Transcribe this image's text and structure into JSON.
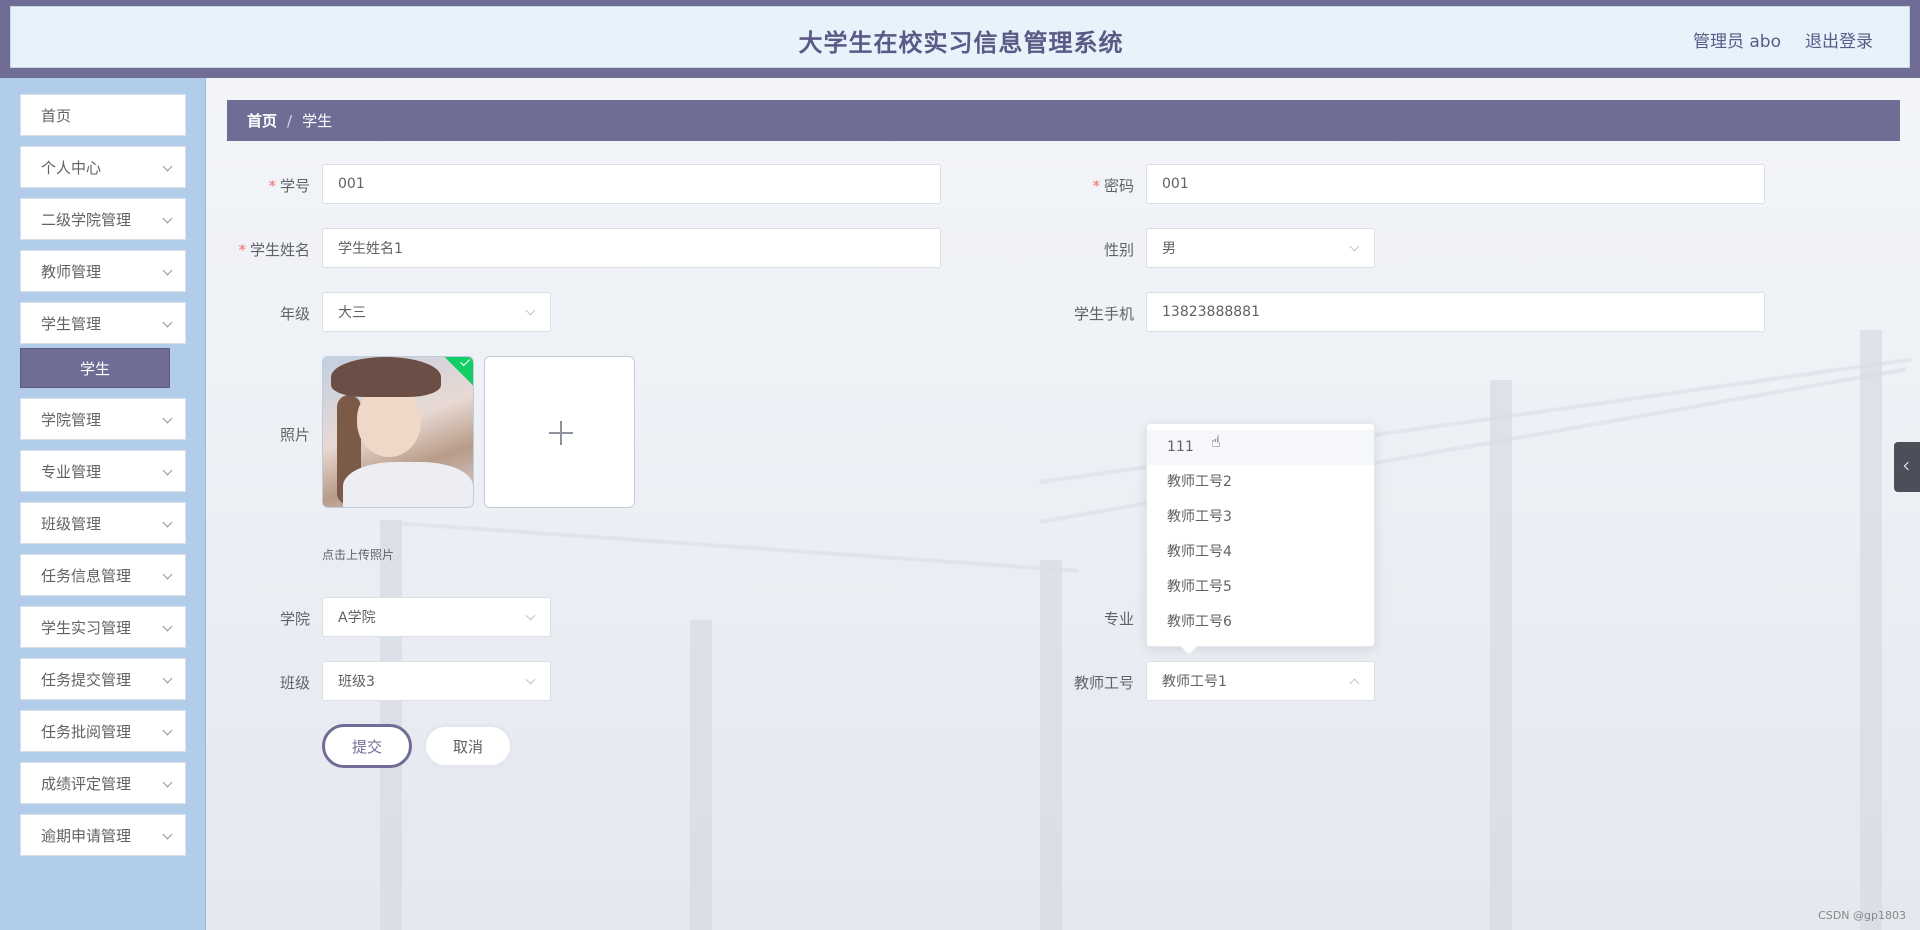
{
  "header": {
    "title": "大学生在校实习信息管理系统",
    "user_label": "管理员 abo",
    "logout_label": "退出登录"
  },
  "sidebar": {
    "items": [
      {
        "label": "首页",
        "has_children": false
      },
      {
        "label": "个人中心",
        "has_children": true
      },
      {
        "label": "二级学院管理",
        "has_children": true
      },
      {
        "label": "教师管理",
        "has_children": true
      },
      {
        "label": "学生管理",
        "has_children": true
      },
      {
        "label": "学院管理",
        "has_children": true
      },
      {
        "label": "专业管理",
        "has_children": true
      },
      {
        "label": "班级管理",
        "has_children": true
      },
      {
        "label": "任务信息管理",
        "has_children": true
      },
      {
        "label": "学生实习管理",
        "has_children": true
      },
      {
        "label": "任务提交管理",
        "has_children": true
      },
      {
        "label": "任务批阅管理",
        "has_children": true
      },
      {
        "label": "成绩评定管理",
        "has_children": true
      },
      {
        "label": "逾期申请管理",
        "has_children": true
      }
    ],
    "active_sub": "学生"
  },
  "breadcrumb": {
    "home": "首页",
    "separator": "/",
    "current": "学生"
  },
  "form": {
    "student_id": {
      "label": "学号",
      "value": "001",
      "required": "*"
    },
    "password": {
      "label": "密码",
      "value": "001",
      "required": "*"
    },
    "student_name": {
      "label": "学生姓名",
      "value": "学生姓名1",
      "required": "*"
    },
    "gender": {
      "label": "性别",
      "value": "男"
    },
    "grade": {
      "label": "年级",
      "value": "大三"
    },
    "phone": {
      "label": "学生手机",
      "value": "13823888881"
    },
    "photo": {
      "label": "照片",
      "tip": "点击上传照片"
    },
    "college": {
      "label": "学院",
      "value": "A学院"
    },
    "major": {
      "label": "专业",
      "value": ""
    },
    "class": {
      "label": "班级",
      "value": "班级3"
    },
    "teacher_id": {
      "label": "教师工号",
      "value": "教师工号1"
    },
    "submit_label": "提交",
    "cancel_label": "取消"
  },
  "teacher_dropdown": {
    "options": [
      "111",
      "教师工号2",
      "教师工号3",
      "教师工号4",
      "教师工号5",
      "教师工号6"
    ],
    "hovered_index": 0
  },
  "watermark": "CSDN @gp1803",
  "colors": {
    "accent": "#6f6d96",
    "header_bg": "#e6f3fb",
    "sidebar_bg": "#b1cde9",
    "required": "#f56c6c",
    "upload_ok": "#13ce66"
  }
}
